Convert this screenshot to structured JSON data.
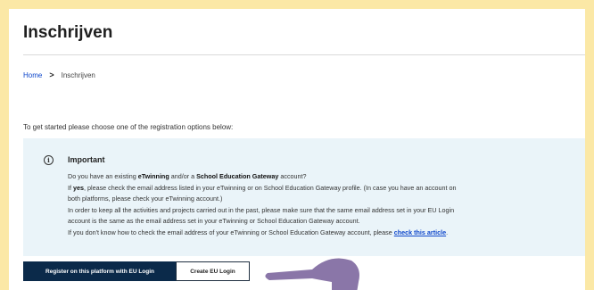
{
  "page": {
    "title": "Inschrijven",
    "background_color": "#fbe8a6"
  },
  "breadcrumb": {
    "home": "Home",
    "separator": ">",
    "current": "Inschrijven"
  },
  "intro": {
    "text": "To get started please choose one of the registration options below:"
  },
  "notice": {
    "icon": "info-icon",
    "icon_glyph": "i",
    "heading": "Important",
    "line1_pre": "Do you have an existing ",
    "line1_b1": "eTwinning",
    "line1_mid": " and/or a ",
    "line1_b2": "School Education Gateway",
    "line1_post": " account?",
    "line2_pre": "If ",
    "line2_b": "yes",
    "line2_post": ", please check the email address listed in your eTwinning or on School Education Gateway profile. (In case you have an account on",
    "line3": "both platforms, please check your eTwinning account.)",
    "line4": "In order to keep all the activities and projects carried out in the past, please make sure that the same email address set in your EU Login",
    "line5": "account is the same as the email address set in your eTwinning or School Education Gateway account.",
    "line6_pre": "If you don't know how to check the email address of your eTwinning or School Education Gateway account, please ",
    "line6_link": "check this article",
    "line6_post": "."
  },
  "buttons": {
    "primary": "Register on this platform with EU Login",
    "secondary": "Create EU Login"
  },
  "colors": {
    "link": "#0e47cb",
    "primary_button": "#0b2a4a",
    "notice_bg": "#eaf4f9",
    "arrow": "#8a76a8"
  }
}
